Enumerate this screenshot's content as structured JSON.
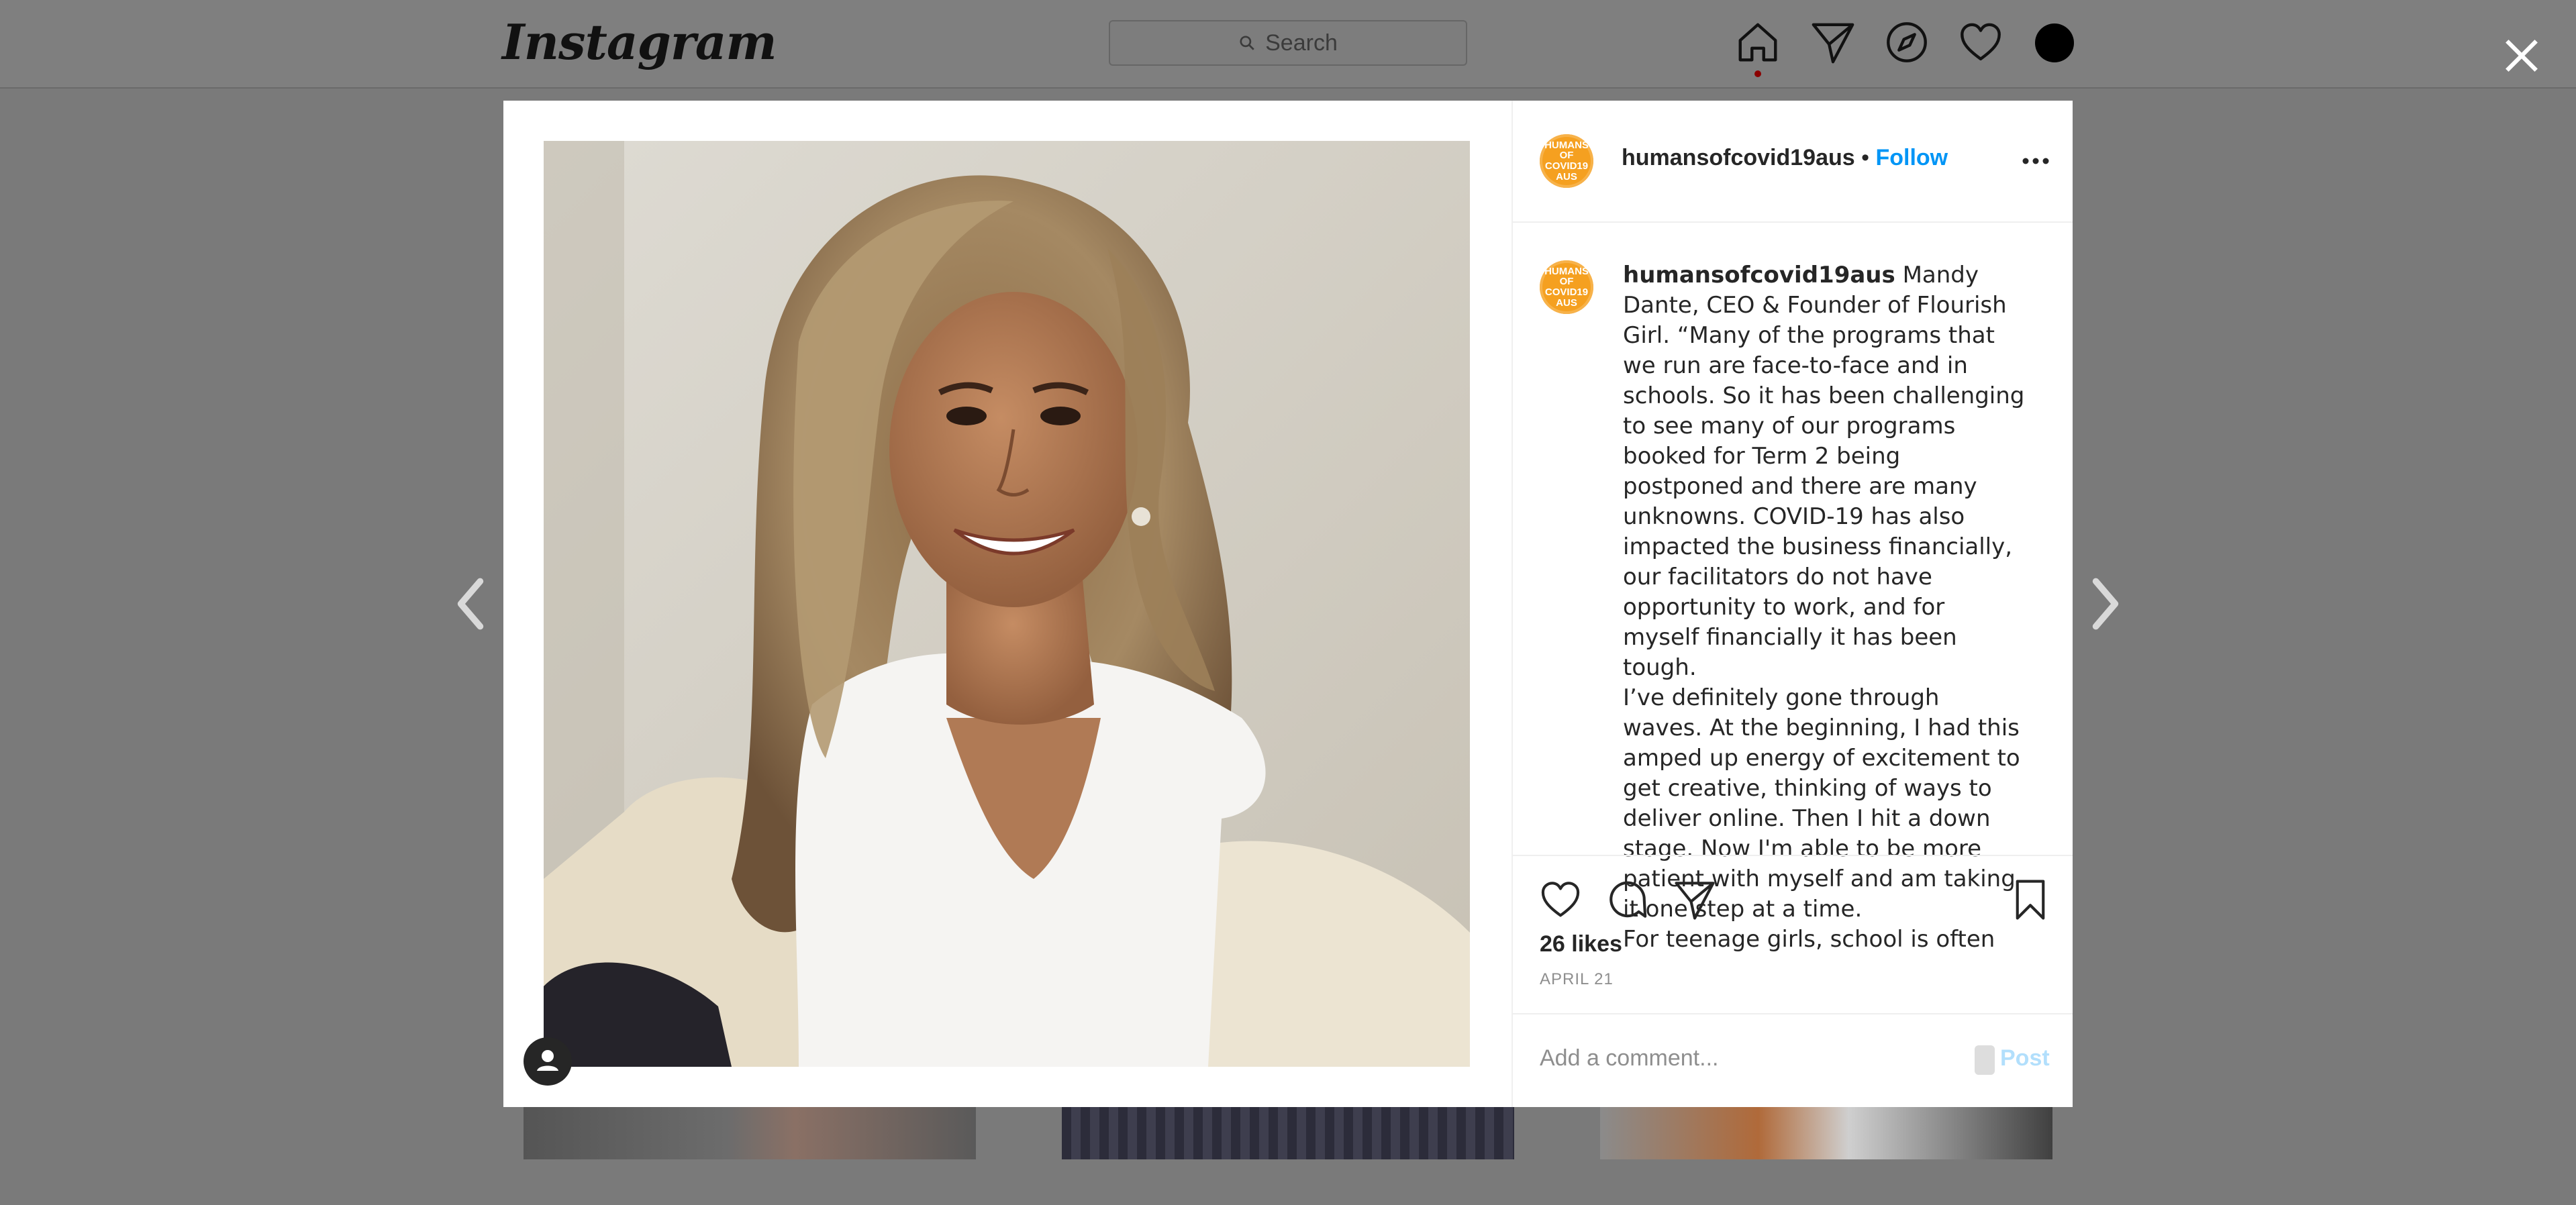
{
  "header": {
    "logo": "Instagram",
    "search_placeholder": "Search"
  },
  "post": {
    "username": "humansofcovid19aus",
    "separator": "•",
    "follow_label": "Follow",
    "badge_text": "HUMANS OF COVID19 AUS",
    "caption_paragraphs": [
      "Mandy Dante, CEO & Founder of Flourish Girl. “Many of the programs that we run are face-to-face and in schools. So it has been challenging to see many of our programs booked for Term 2 being postponed and there are many unknowns. COVID-19 has also impacted the business financially, our facilitators do not have opportunity to work, and for myself financially it has been tough.",
      "I’ve definitely gone through waves. At the beginning, I had this amped up energy of excitement to get creative, thinking of ways to deliver online. Then I hit a down stage. Now I'm able to be more patient with myself and am taking it one step at a time.",
      "For teenage girls, school is often seen"
    ],
    "likes": "26 likes",
    "date": "APRIL 21",
    "comment_placeholder": "Add a comment...",
    "post_label": "Post"
  },
  "colors": {
    "accent": "#0095f6",
    "badge": "#f5a020",
    "overlay": "#7a7a7a"
  }
}
